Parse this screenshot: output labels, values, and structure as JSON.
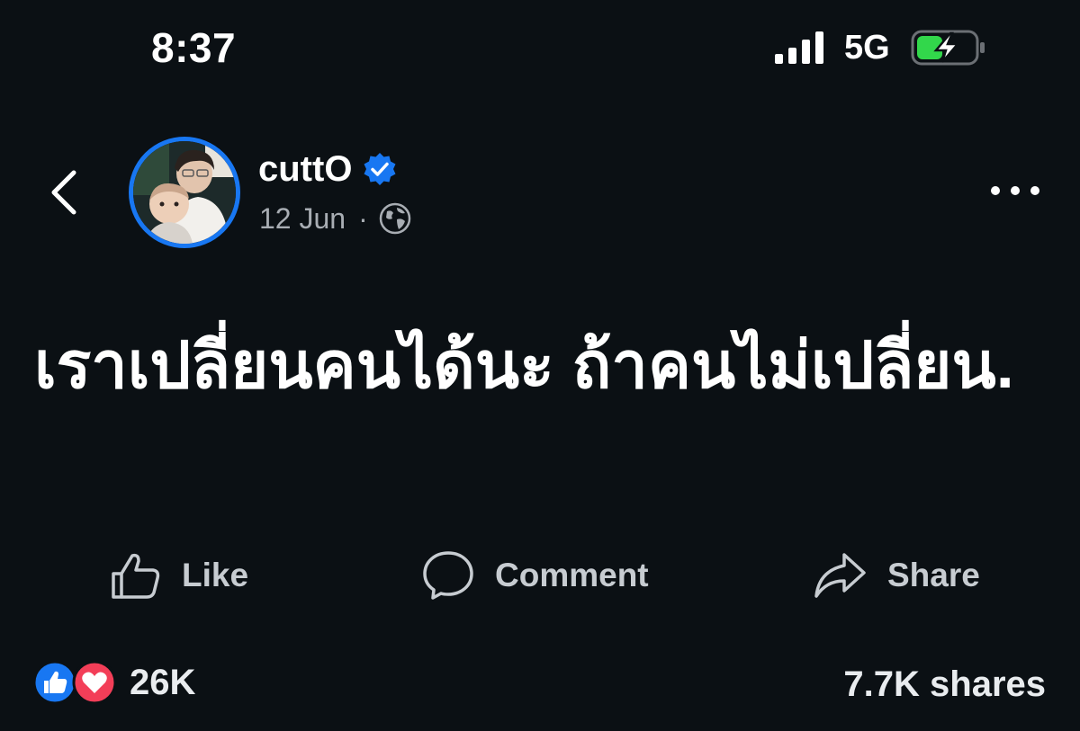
{
  "status_bar": {
    "time": "8:37",
    "network": "5G",
    "signal_icon": "signal-bars-icon",
    "battery_icon": "battery-charging-icon",
    "battery_color": "#32d74b"
  },
  "header": {
    "back_icon": "chevron-left-icon",
    "author": "cuttO",
    "verified_icon": "verified-badge-icon",
    "date": "12 Jun",
    "separator": "·",
    "privacy_icon": "globe-icon",
    "more_icon": "more-horizontal-icon"
  },
  "post": {
    "text": "เราเปลี่ยนคนได้นะ ถ้าคนไม่เปลี่ยน."
  },
  "actions": [
    {
      "label": "Like",
      "icon": "thumbs-up-icon"
    },
    {
      "label": "Comment",
      "icon": "comment-bubble-icon"
    },
    {
      "label": "Share",
      "icon": "share-arrow-icon"
    }
  ],
  "footer": {
    "reaction_count": "26K",
    "shares": "7.7K shares",
    "like_color": "#1877f2",
    "love_color": "#f33e58"
  },
  "colors": {
    "background": "#0b1014",
    "accent": "#1877f2",
    "muted_text": "#a8adb3"
  }
}
